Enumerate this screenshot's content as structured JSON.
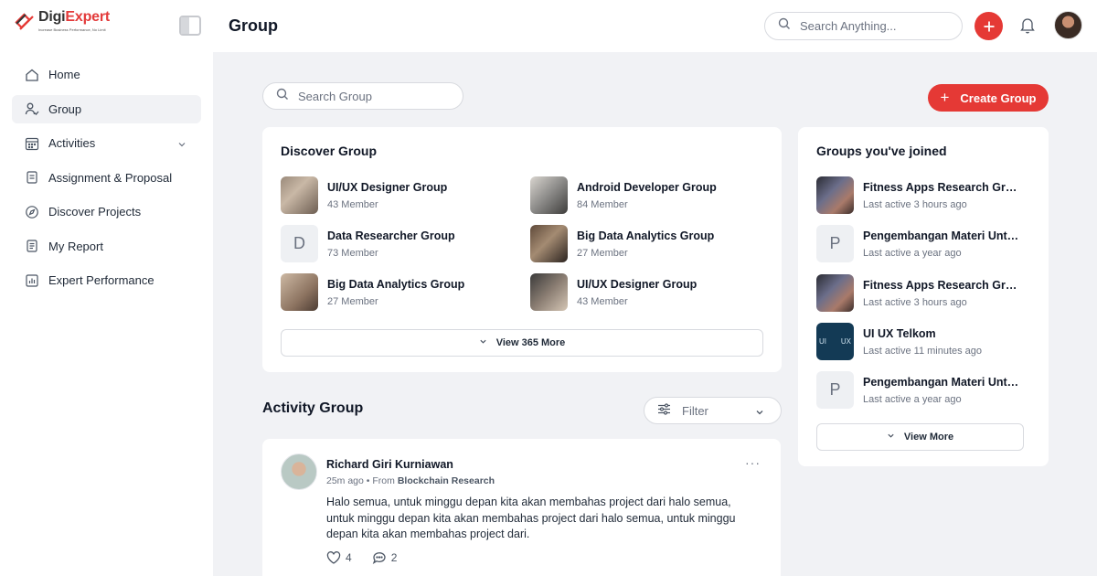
{
  "brand": {
    "name_part1": "Digi",
    "name_part2": "Expert",
    "tagline": "Increase Business Performance, No Limit",
    "accent": "#e53935"
  },
  "sidebar": {
    "items": [
      {
        "label": "Home",
        "icon": "home-icon",
        "active": false
      },
      {
        "label": "Group",
        "icon": "group-icon",
        "active": true
      },
      {
        "label": "Activities",
        "icon": "calendar-icon",
        "active": false,
        "expandable": true
      },
      {
        "label": "Assignment & Proposal",
        "icon": "assignment-icon",
        "active": false
      },
      {
        "label": "Discover Projects",
        "icon": "compass-icon",
        "active": false
      },
      {
        "label": "My Report",
        "icon": "report-icon",
        "active": false
      },
      {
        "label": "Expert Performance",
        "icon": "chart-icon",
        "active": false
      }
    ]
  },
  "header": {
    "title": "Group",
    "search_placeholder": "Search Anything..."
  },
  "main": {
    "search_group_placeholder": "Search Group",
    "create_group_label": "Create Group",
    "discover": {
      "title": "Discover Group",
      "groups": [
        {
          "name": "UI/UX Designer Group",
          "members": "43 Member"
        },
        {
          "name": "Android Developer Group",
          "members": "84 Member"
        },
        {
          "name": "Data Researcher Group",
          "members": "73 Member",
          "letter": "D"
        },
        {
          "name": "Big Data Analytics Group",
          "members": "27 Member"
        },
        {
          "name": "Big Data Analytics Group",
          "members": "27 Member"
        },
        {
          "name": "UI/UX Designer Group",
          "members": "43 Member"
        }
      ],
      "view_more_label": "View 365 More"
    },
    "joined": {
      "title": "Groups you've joined",
      "groups": [
        {
          "name": "Fitness Apps Research Group",
          "last_active": "Last active 3 hours ago"
        },
        {
          "name": "Pengembangan Materi Untuk...",
          "last_active": "Last active a year ago",
          "letter": "P"
        },
        {
          "name": "Fitness Apps Research Group",
          "last_active": "Last active 3 hours ago"
        },
        {
          "name": "UI UX Telkom",
          "last_active": "Last active 11 minutes ago",
          "thumb_left": "UI",
          "thumb_right": "UX"
        },
        {
          "name": "Pengembangan Materi Untuk...",
          "last_active": "Last active a year ago",
          "letter": "P"
        }
      ],
      "view_more_label": "View More"
    },
    "activity": {
      "title": "Activity Group",
      "filter_label": "Filter",
      "posts": [
        {
          "author": "Richard Giri Kurniawan",
          "time": "25m ago",
          "from_prefix": "From",
          "source": "Blockchain Research",
          "body": "Halo semua, untuk minggu depan kita akan membahas project dari halo semua, untuk minggu depan kita akan membahas project dari halo semua, untuk minggu depan kita akan membahas project dari.",
          "likes": "4",
          "comments": "2"
        }
      ]
    }
  }
}
